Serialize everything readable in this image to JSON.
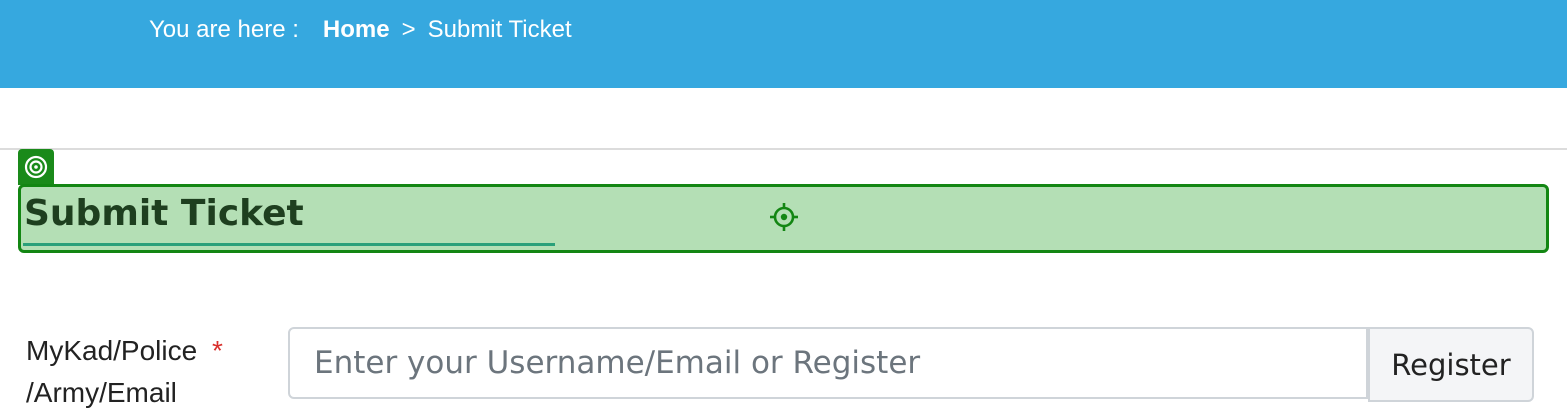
{
  "colors": {
    "accent": "#36a8df",
    "highlight_fill": "#b4dfb5",
    "highlight_border": "#138613",
    "required": "#d9302c"
  },
  "breadcrumb": {
    "prefix": "You are here :",
    "home": "Home",
    "separator": ">",
    "current": "Submit Ticket"
  },
  "page": {
    "title": "Submit Ticket"
  },
  "form": {
    "id_label_line1": "MyKad/Police",
    "id_label_line2": "/Army/Email",
    "required_marker": "*",
    "username_placeholder": "Enter your Username/Email or Register",
    "username_value": "",
    "register_label": "Register"
  },
  "icons": {
    "highlight_tab": "target-icon",
    "center_marker": "crosshair-icon"
  }
}
